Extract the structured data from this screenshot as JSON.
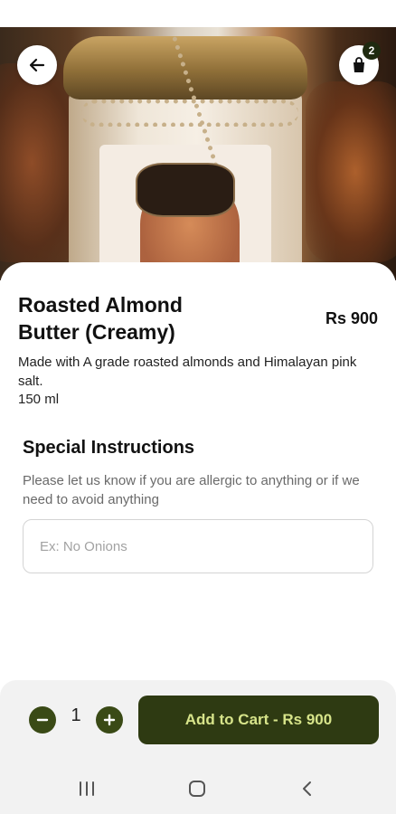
{
  "header": {
    "back_icon": "arrow-left-icon",
    "cart_icon": "shopping-bag-icon",
    "cart_count": "2"
  },
  "product": {
    "name": "Roasted Almond Butter (Creamy)",
    "price": "Rs 900",
    "description": "Made with A grade roasted almonds and Himalayan pink salt.",
    "size": "150 ml"
  },
  "instructions": {
    "title": "Special Instructions",
    "hint": "Please let us know if you are allergic to anything or if we need to avoid anything",
    "placeholder": "Ex: No Onions",
    "value": ""
  },
  "cart_bar": {
    "minus_icon": "minus-icon",
    "plus_icon": "plus-icon",
    "quantity": "1",
    "add_label": "Add to Cart - Rs 900"
  },
  "system_nav": {
    "recent_icon": "recent-apps-icon",
    "home_icon": "home-icon",
    "back_icon": "back-chevron-icon"
  },
  "colors": {
    "primary": "#2e3a12",
    "button_text": "#d7e48a",
    "qty_button": "#3a4a16"
  }
}
